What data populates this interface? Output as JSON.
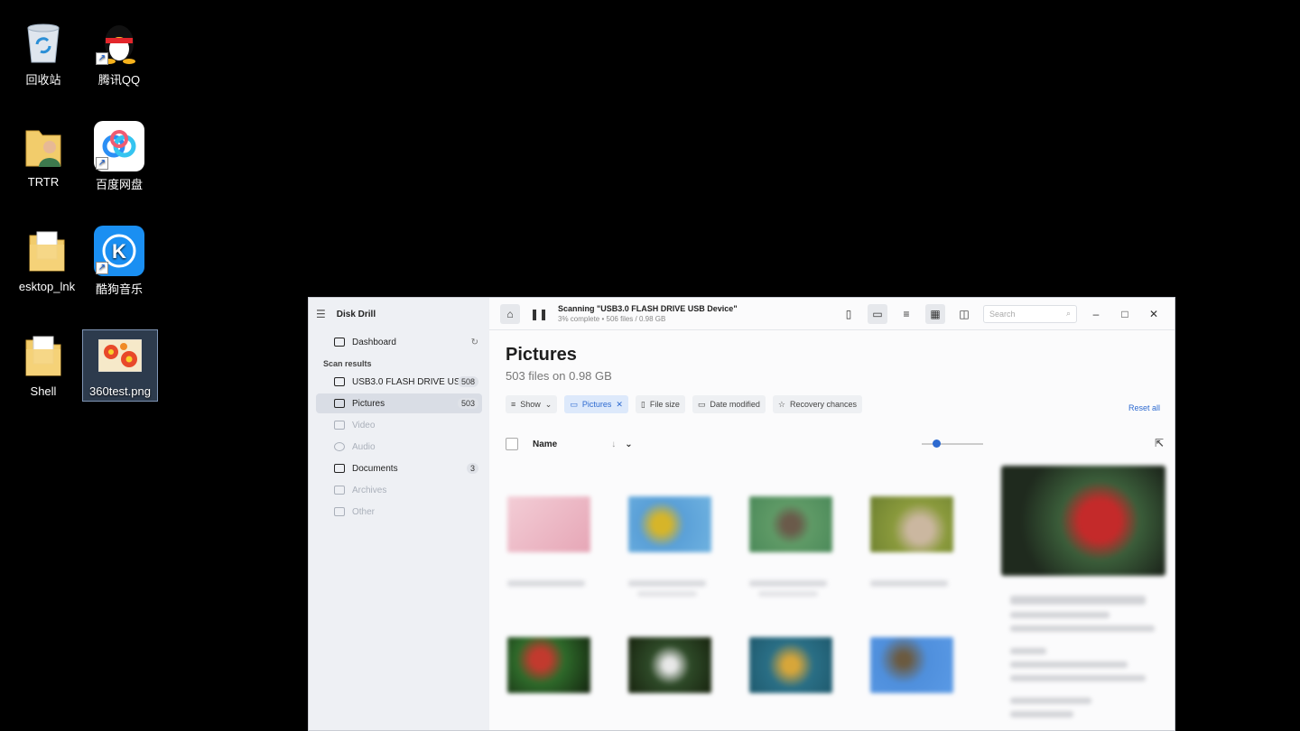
{
  "desktop": {
    "icons": [
      {
        "label": "回收站"
      },
      {
        "label": "腾讯QQ"
      },
      {
        "label": "TRTR"
      },
      {
        "label": "百度网盘"
      },
      {
        "label": "esktop_lnk"
      },
      {
        "label": "酷狗音乐"
      },
      {
        "label": "Shell"
      },
      {
        "label": "360test.png"
      }
    ]
  },
  "window": {
    "app_title": "Disk Drill",
    "sidebar": {
      "dashboard": "Dashboard",
      "section": "Scan results",
      "device": {
        "label": "USB3.0 FLASH DRIVE US...",
        "count": "508"
      },
      "items": [
        {
          "label": "Pictures",
          "count": "503"
        },
        {
          "label": "Video",
          "count": ""
        },
        {
          "label": "Audio",
          "count": ""
        },
        {
          "label": "Documents",
          "count": "3"
        },
        {
          "label": "Archives",
          "count": ""
        },
        {
          "label": "Other",
          "count": ""
        }
      ]
    },
    "topbar": {
      "scan_title": "Scanning \"USB3.0 FLASH DRIVE USB Device\"",
      "scan_sub": "3% complete • 506 files / 0.98 GB",
      "search_placeholder": "Search"
    },
    "main": {
      "title": "Pictures",
      "subtitle": "503 files on 0.98 GB",
      "filters": {
        "show": "Show",
        "pictures": "Pictures",
        "file_size": "File size",
        "date_modified": "Date modified",
        "recovery": "Recovery chances",
        "reset": "Reset all"
      },
      "column_name": "Name"
    },
    "colors": {
      "accent": "#2d6ad0"
    }
  }
}
